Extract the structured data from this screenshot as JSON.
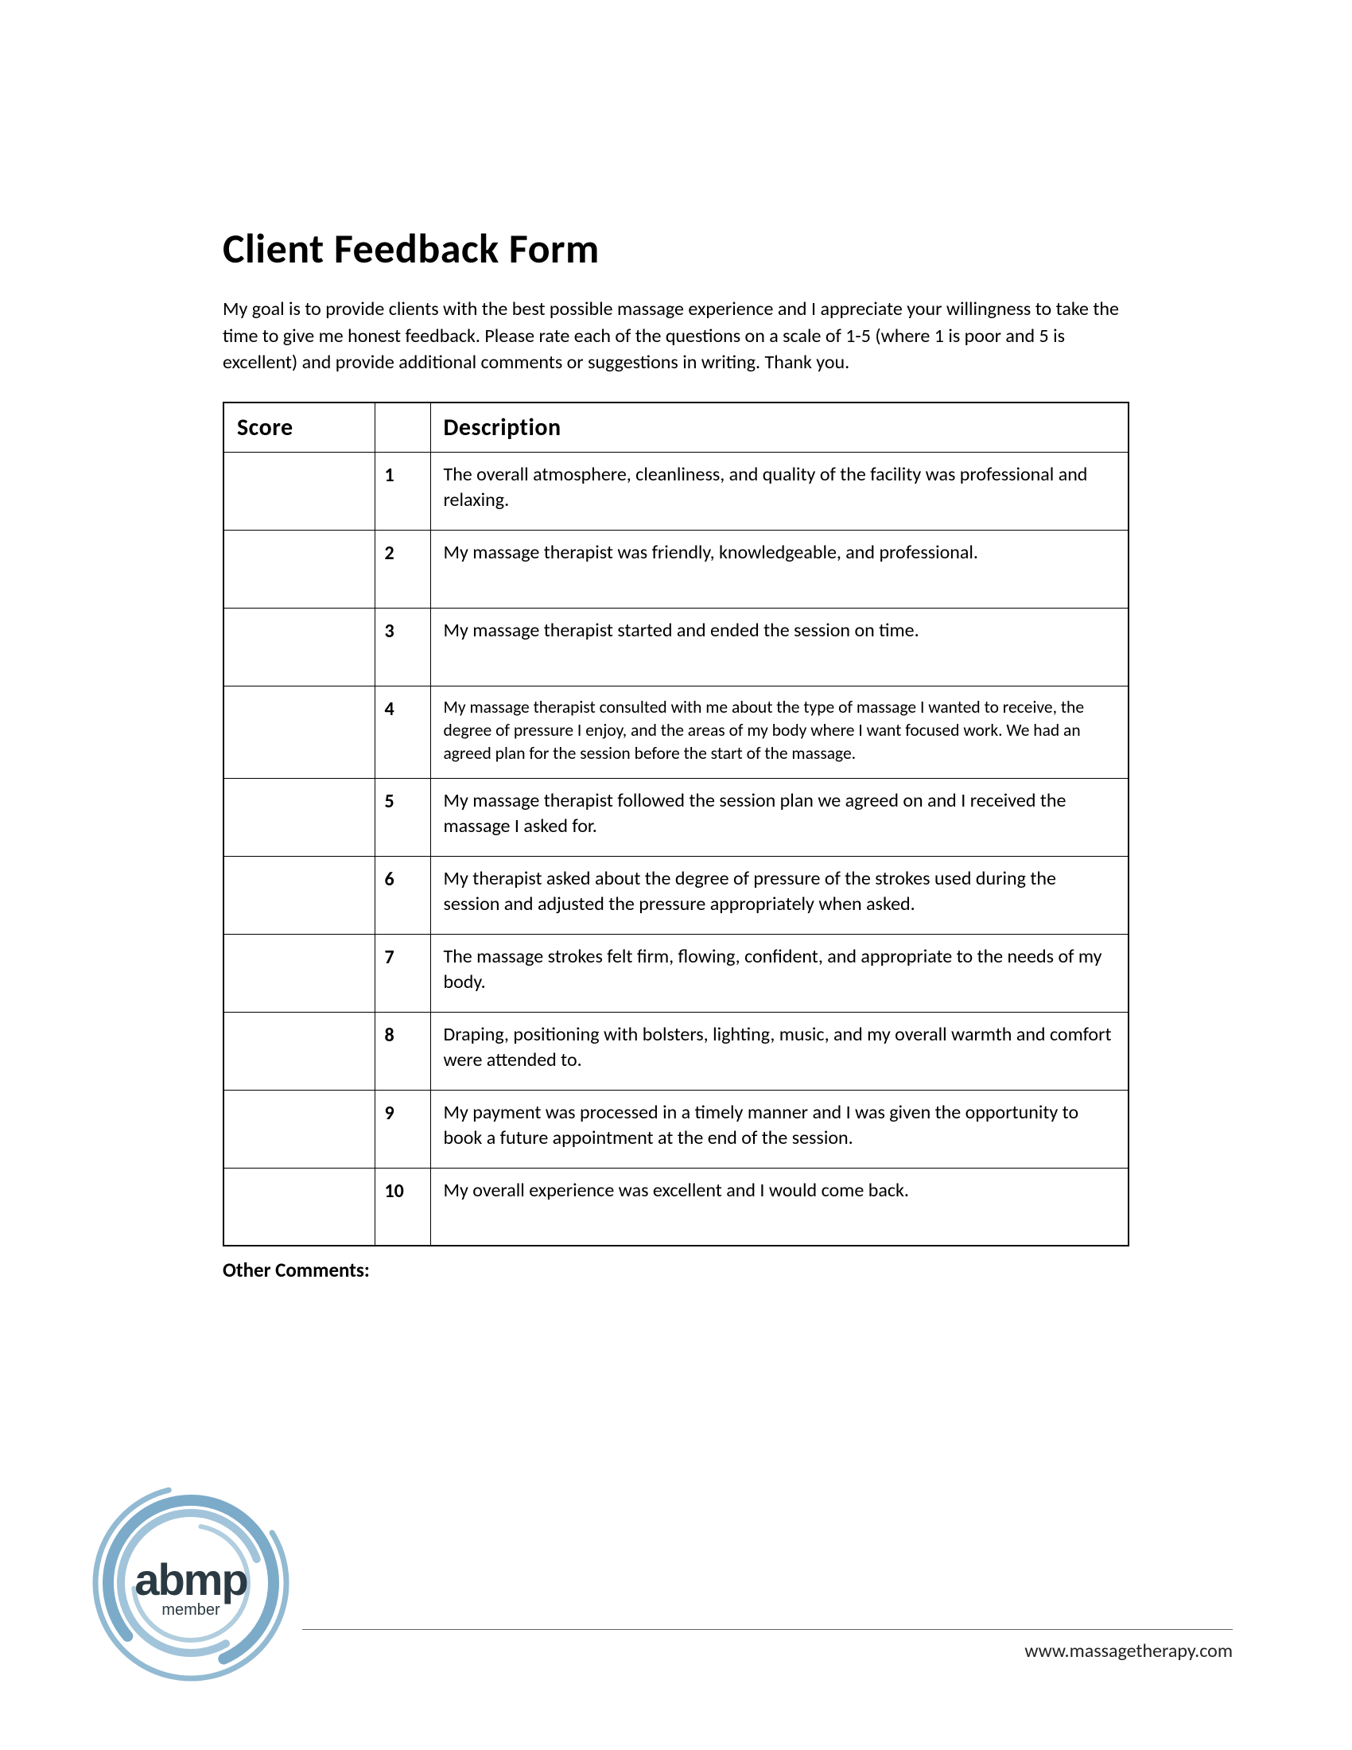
{
  "title": "Client Feedback Form",
  "intro": "My goal is to provide clients with the best possible massage experience and I appreciate your willingness to take the time to give me honest feedback. Please rate each of the questions on a scale of 1-5 (where 1 is poor and 5 is excellent) and provide additional comments or suggestions in writing. Thank you.",
  "table": {
    "headers": {
      "score": "Score",
      "description": "Description"
    },
    "rows": [
      {
        "num": "1",
        "desc": "The overall atmosphere, cleanliness, and quality of the facility was professional and relaxing."
      },
      {
        "num": "2",
        "desc": "My massage therapist was friendly, knowledgeable, and professional."
      },
      {
        "num": "3",
        "desc": "My massage therapist started and ended the session on time."
      },
      {
        "num": "4",
        "desc": "My massage therapist consulted with me about the type of massage I wanted to receive, the degree of pressure I enjoy, and the areas of my body where I want focused work. We had an agreed plan for the session before the start of the massage."
      },
      {
        "num": "5",
        "desc": "My massage therapist followed the session plan we agreed on and I received the massage I asked for."
      },
      {
        "num": "6",
        "desc": "My therapist asked about the degree of pressure of the strokes used during the session and adjusted the pressure appropriately when asked."
      },
      {
        "num": "7",
        "desc": "The massage strokes felt firm, flowing, confident, and appropriate to the needs of my body."
      },
      {
        "num": "8",
        "desc": "Draping, positioning with bolsters, lighting, music, and my overall warmth and comfort were attended to."
      },
      {
        "num": "9",
        "desc": "My payment was processed in a timely manner and I was given the opportunity to book a future appointment at the end of the session."
      },
      {
        "num": "10",
        "desc": "My overall experience was excellent and I would come back."
      }
    ]
  },
  "other_comments_label": "Other Comments:",
  "footer": {
    "url": "www.massagetherapy.com"
  },
  "logo": {
    "text": "abmp",
    "subtext": "member"
  }
}
